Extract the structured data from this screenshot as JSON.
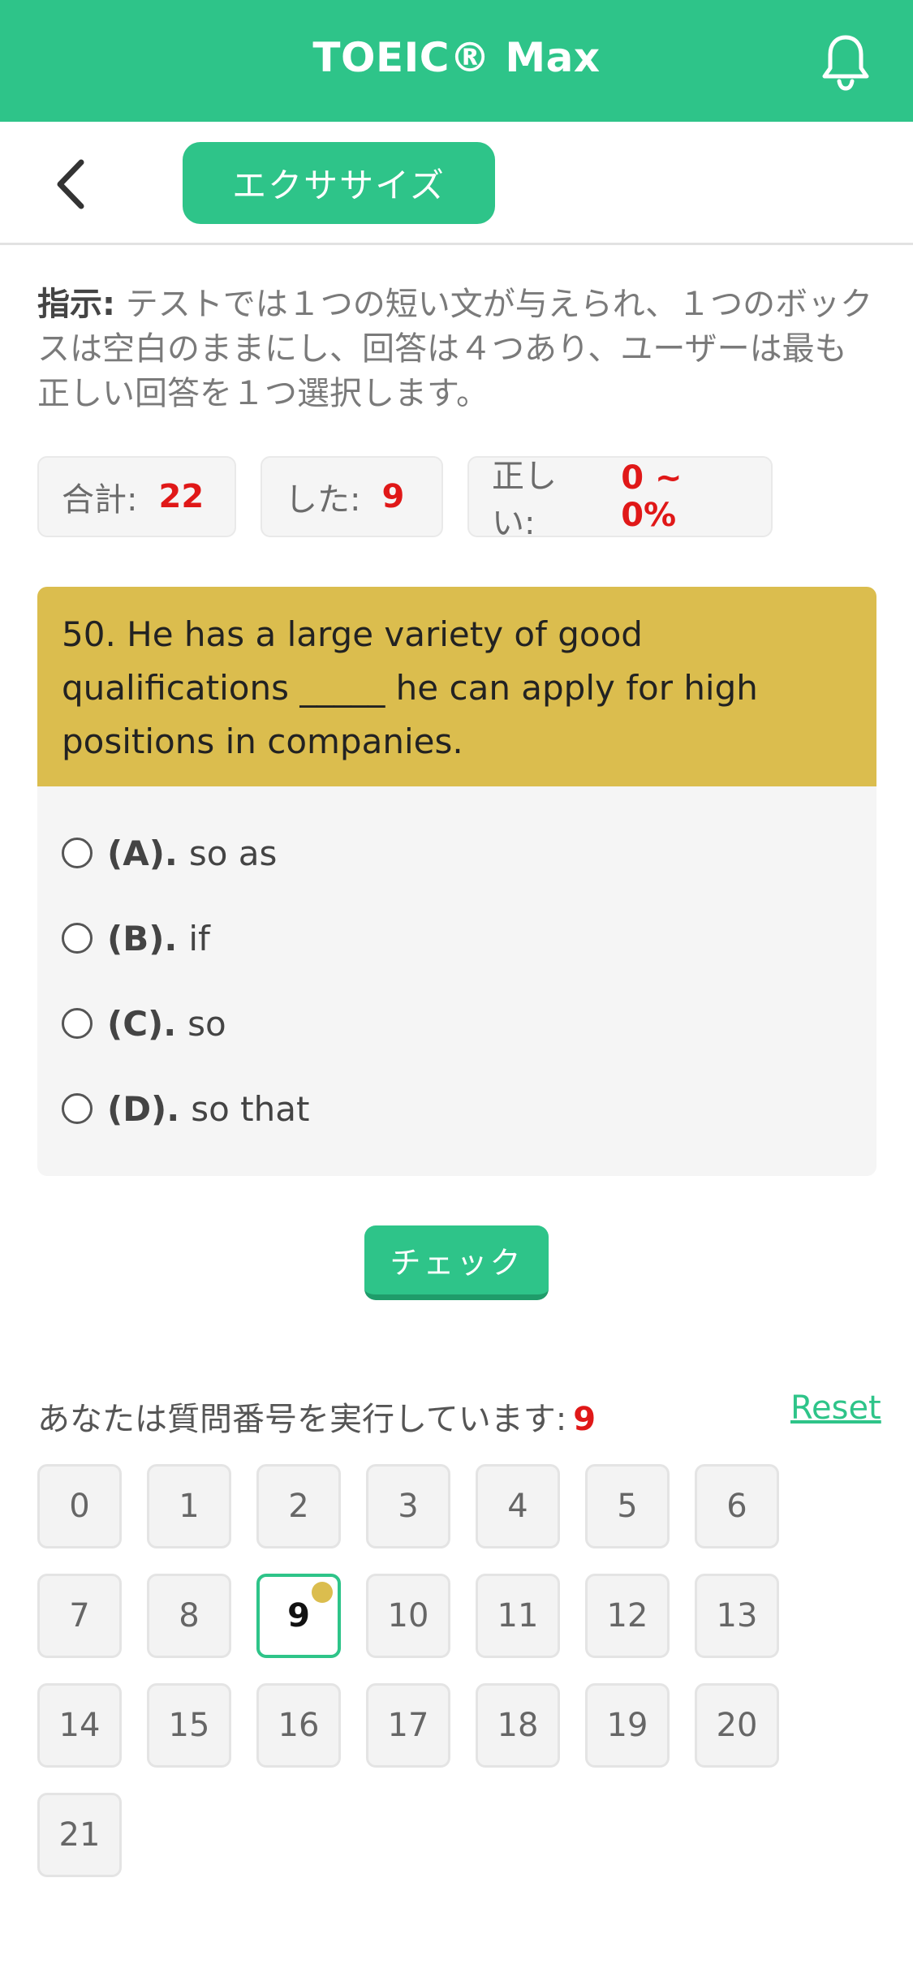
{
  "app": {
    "title": "TOEIC® Max"
  },
  "header": {
    "tab_label": "エクササイズ"
  },
  "instructions": {
    "label": "指示:",
    "text": " テストでは１つの短い文が与えられ、１つのボックスは空白のままにし、回答は４つあり、ユーザーは最も正しい回答を１つ選択します。"
  },
  "stats": {
    "total_label": "合計:",
    "total_value": "22",
    "done_label": "した:",
    "done_value": "9",
    "correct_label": "正しい:",
    "correct_value": "0 ~ 0%"
  },
  "question": {
    "text": "50. He has a large variety of good qualifications _____ he can apply for high positions in companies.",
    "options": [
      {
        "label": "(A).",
        "text": "so as"
      },
      {
        "label": "(B).",
        "text": "if"
      },
      {
        "label": "(C).",
        "text": "so"
      },
      {
        "label": "(D).",
        "text": "so that"
      }
    ]
  },
  "check_label": "チェック",
  "progress": {
    "running_label": "あなたは質問番号を実行しています:",
    "current": "9",
    "reset_label": "Reset"
  },
  "numbers": [
    "0",
    "1",
    "2",
    "3",
    "4",
    "5",
    "6",
    "7",
    "8",
    "9",
    "10",
    "11",
    "12",
    "13",
    "14",
    "15",
    "16",
    "17",
    "18",
    "19",
    "20",
    "21"
  ],
  "colors": {
    "accent": "#2ec489",
    "question_bg": "#dbbd4e",
    "value_red": "#e01818"
  }
}
